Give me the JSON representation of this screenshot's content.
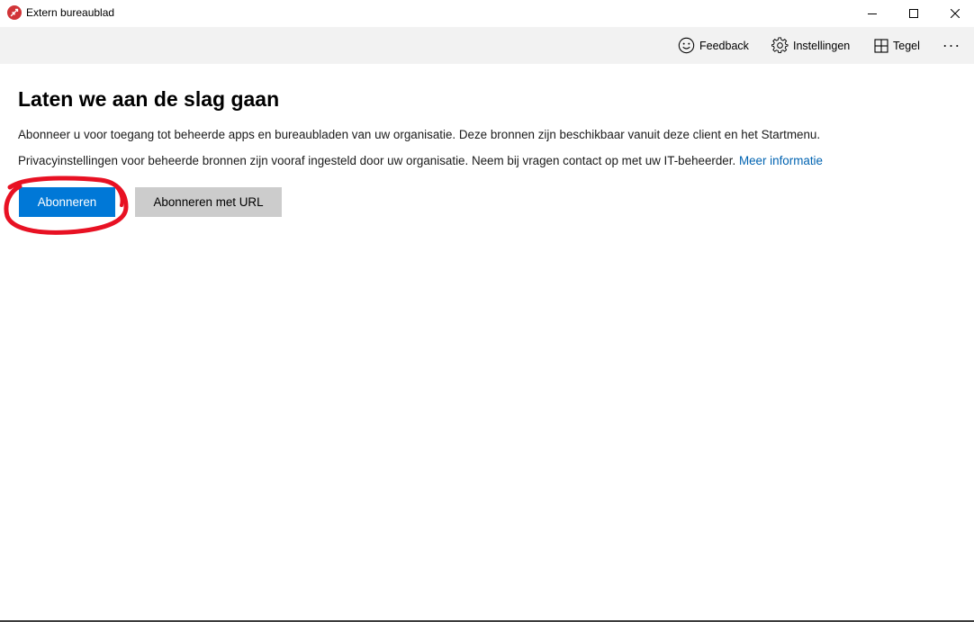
{
  "window": {
    "title": "Extern bureaublad",
    "icon": "remote-desktop-icon",
    "controls": [
      "minimize-icon",
      "maximize-icon",
      "close-icon"
    ]
  },
  "commandbar": {
    "feedback_label": "Feedback",
    "settings_label": "Instellingen",
    "tile_label": "Tegel",
    "more_label": "···"
  },
  "main": {
    "heading": "Laten we aan de slag gaan",
    "paragraph1": "Abonneer u voor toegang tot beheerde apps en bureaubladen van uw organisatie. Deze bronnen zijn beschikbaar vanuit deze client en het Startmenu.",
    "paragraph2": "Privacyinstellingen voor beheerde bronnen zijn vooraf ingesteld door uw organisatie. Neem bij vragen contact op met uw IT-beheerder.",
    "more_info_link": "Meer informatie",
    "subscribe_button": "Abonneren",
    "subscribe_url_button": "Abonneren met URL"
  },
  "colors": {
    "accent": "#0078d7",
    "link": "#0063b1",
    "secondary_button": "#cccccc",
    "commandbar_bg": "#f2f2f2",
    "annotation": "#e81123",
    "app_icon": "#d13438"
  }
}
